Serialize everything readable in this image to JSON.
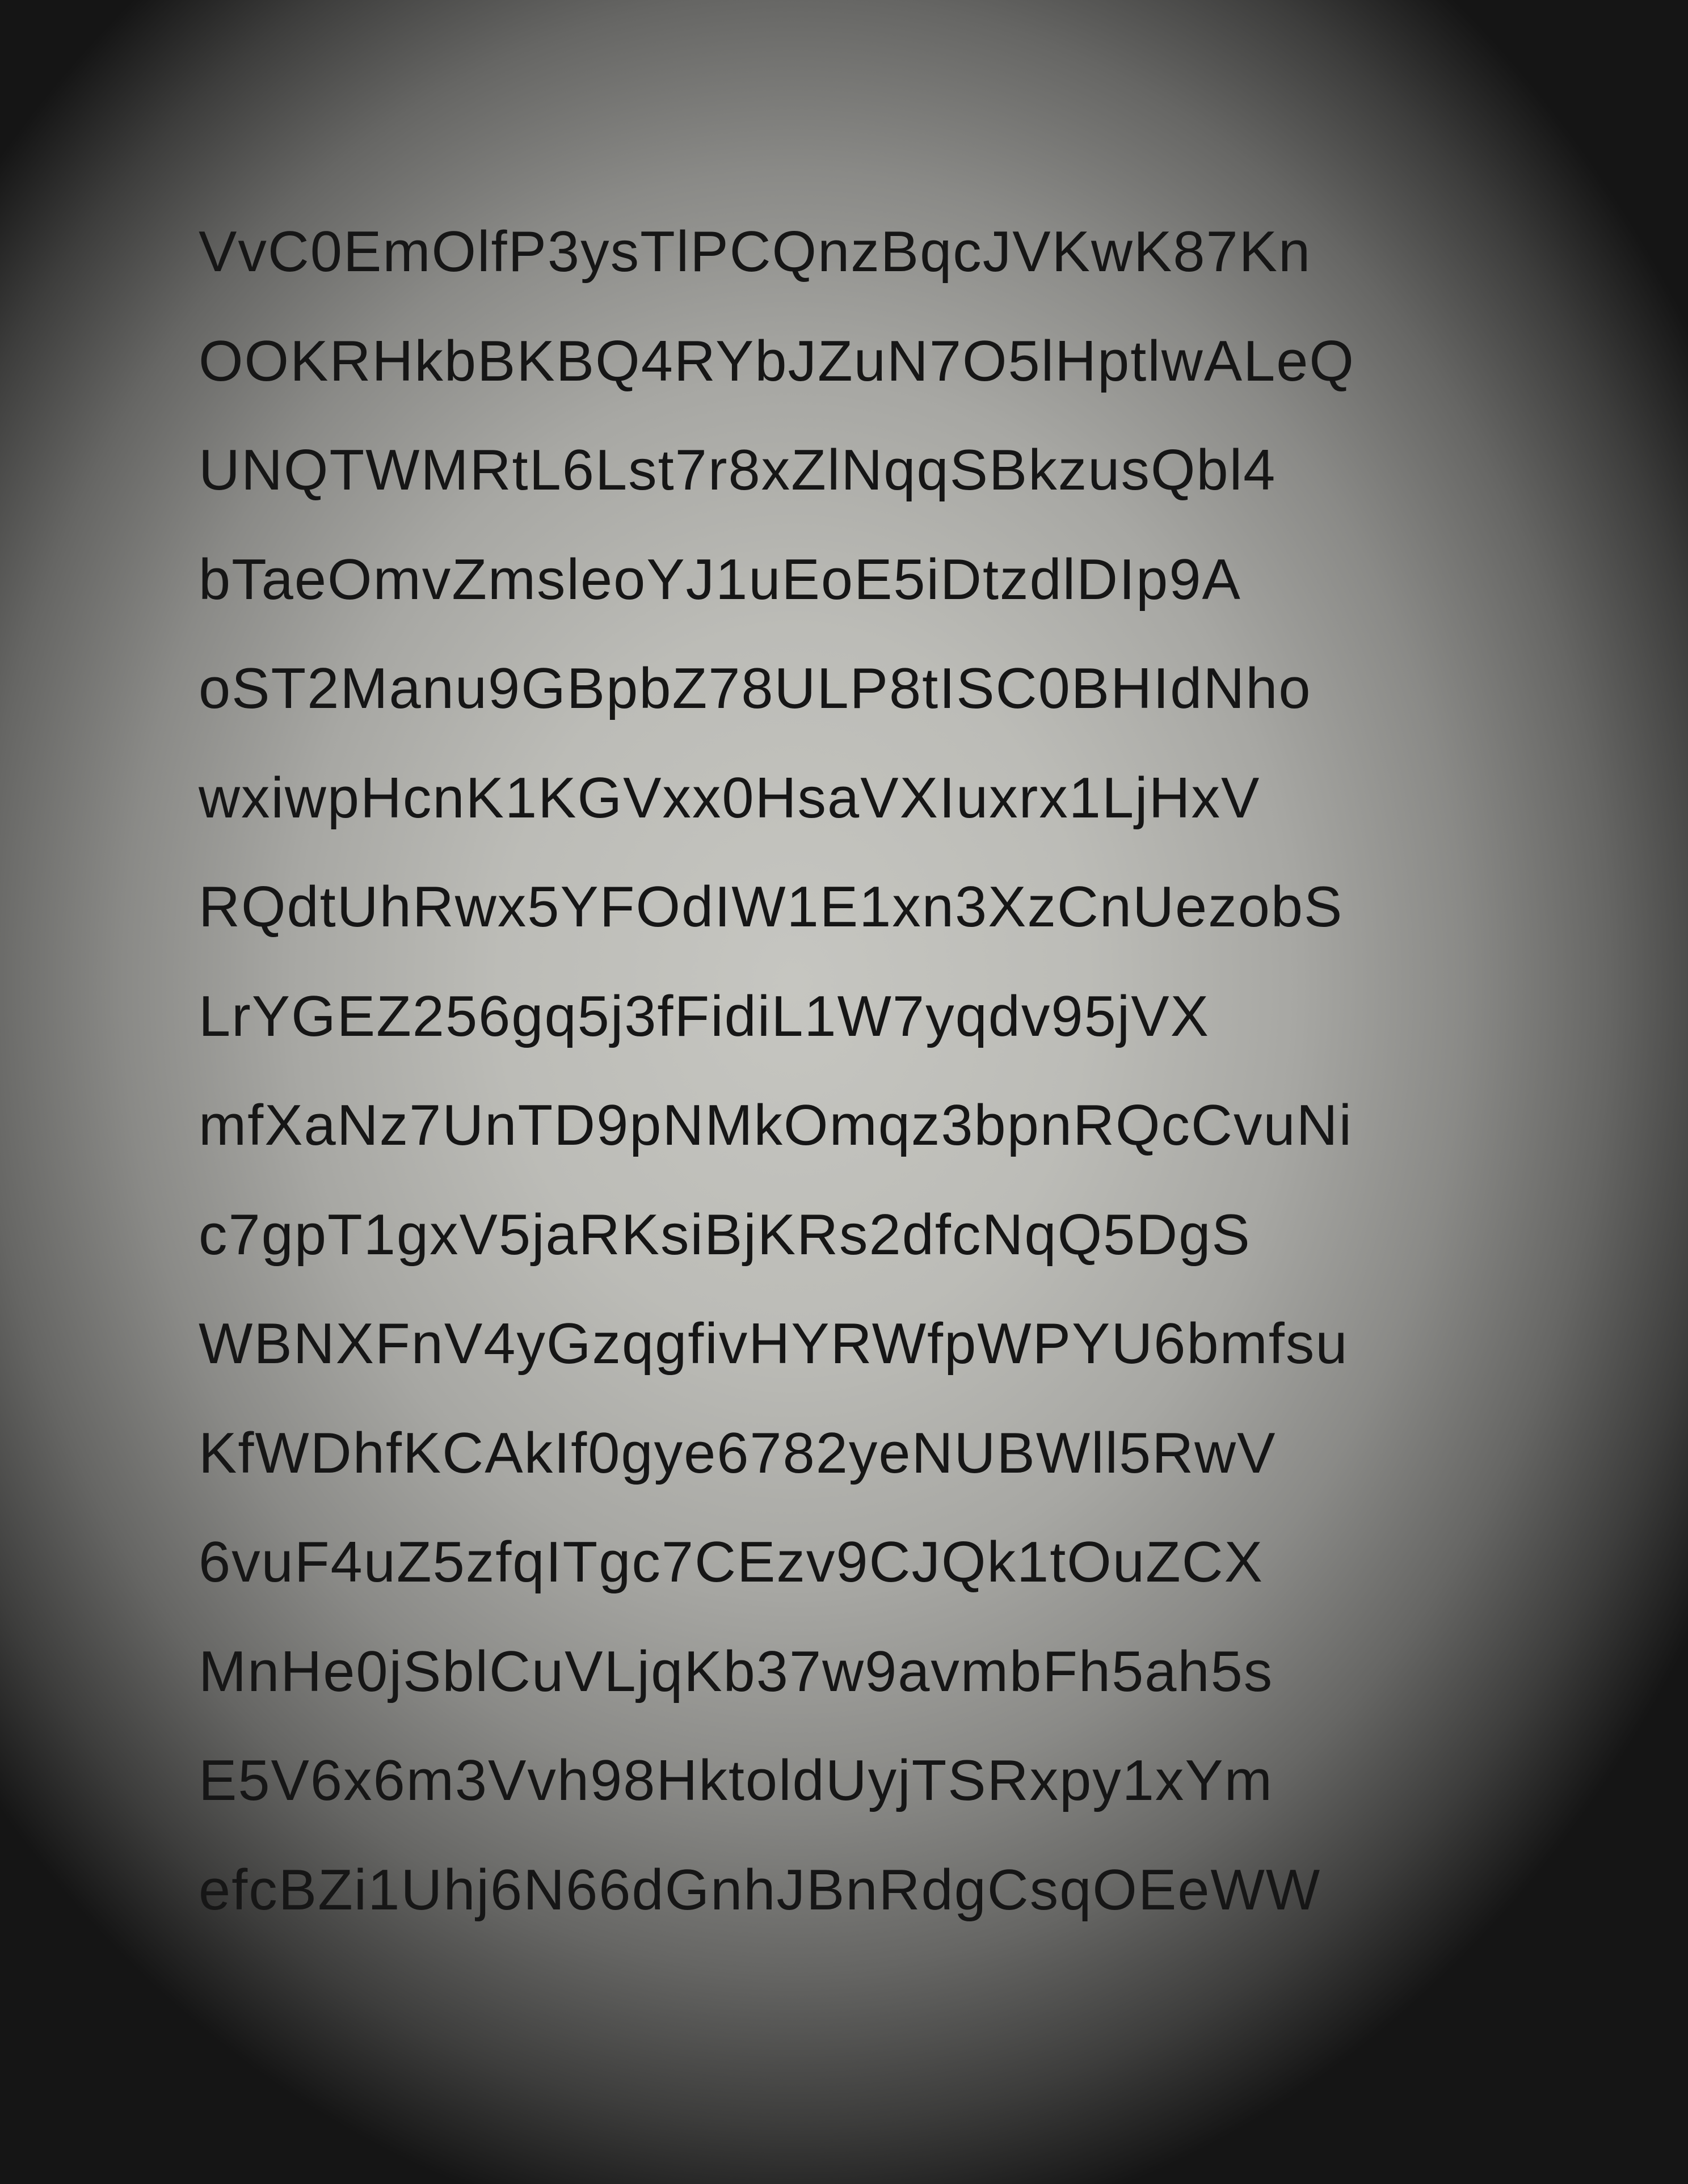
{
  "lines": [
    "VvC0EmOlfP3ysTlPCQnzBqcJVKwK87Kn",
    "OOKRHkbBKBQ4RYbJZuN7O5lHptlwALeQ",
    "UNQTWMRtL6Lst7r8xZlNqqSBkzusQbl4",
    "bTaeOmvZmsleoYJ1uEoE5iDtzdlDIp9A",
    "oST2Manu9GBpbZ78ULP8tISC0BHIdNho",
    "wxiwpHcnK1KGVxx0HsaVXIuxrx1LjHxV",
    "RQdtUhRwx5YFOdIW1E1xn3XzCnUezobS",
    "LrYGEZ256gq5j3fFidiL1W7yqdv95jVX",
    "mfXaNz7UnTD9pNMkOmqz3bpnRQcCvuNi",
    "c7gpT1gxV5jaRKsiBjKRs2dfcNqQ5DgS",
    "WBNXFnV4yGzqgfivHYRWfpWPYU6bmfsu",
    "KfWDhfKCAkIf0gye6782yeNUBWll5RwV",
    "6vuF4uZ5zfqITgc7CEzv9CJQk1tOuZCX",
    "MnHe0jSblCuVLjqKb37w9avmbFh5ah5s",
    "E5V6x6m3Vvh98HktoldUyjTSRxpy1xYm",
    "efcBZi1Uhj6N66dGnhJBnRdgCsqOEeWW"
  ]
}
